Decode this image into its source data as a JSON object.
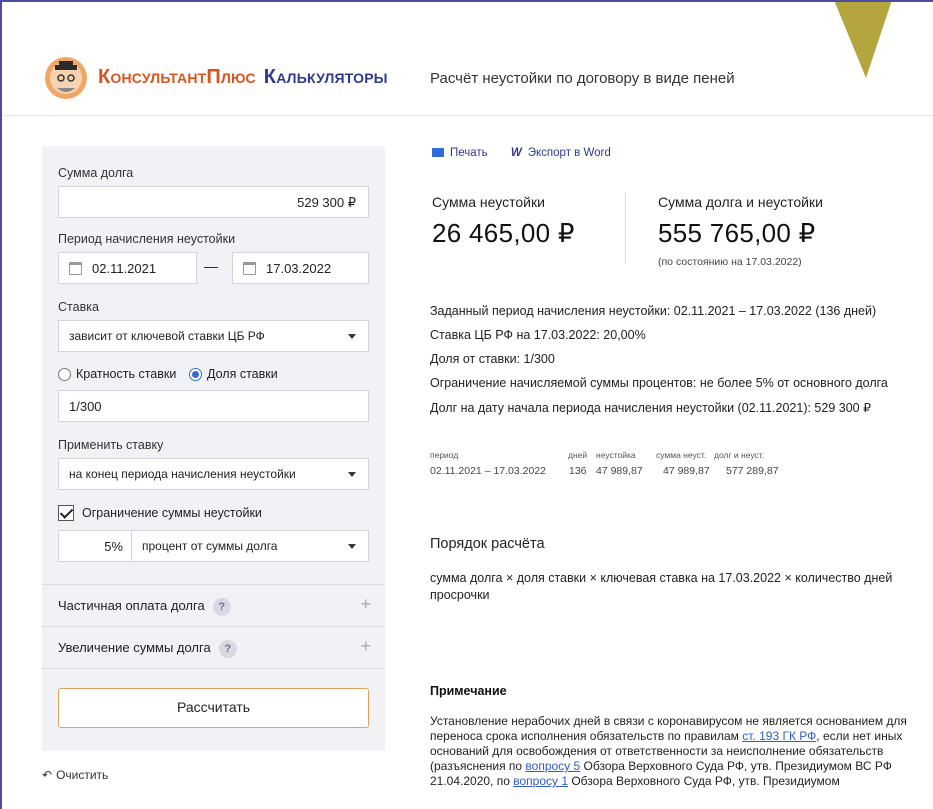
{
  "header": {
    "brand_part1": "КонсультантПлюс",
    "brand_part2": "Калькуляторы",
    "page_title": "Расчёт неустойки по договору в виде пеней"
  },
  "form": {
    "debt_label": "Сумма долга",
    "debt_value": "529 300 ₽",
    "period_label": "Период начисления неустойки",
    "date_from": "02.11.2021",
    "date_to": "17.03.2022",
    "rate_label": "Ставка",
    "rate_value": "зависит от ключевой ставки ЦБ РФ",
    "radio_multiple": "Кратность ставки",
    "radio_share": "Доля ставки",
    "share_value": "1/300",
    "apply_label": "Применить ставку",
    "apply_value": "на конец периода начисления неустойки",
    "limit_label": "Ограничение суммы неустойки",
    "limit_percent": "5%",
    "limit_type": "процент от суммы долга",
    "partial_payment": "Частичная оплата долга",
    "debt_increase": "Увеличение суммы долга",
    "help_mark": "?",
    "plus_mark": "+",
    "calculate": "Рассчитать",
    "clear": "Очистить"
  },
  "toolbar": {
    "print": "Печать",
    "export_word": "Экспорт в Word"
  },
  "result": {
    "penalty_label": "Сумма неустойки",
    "penalty_value": "26 465,00 ₽",
    "total_label": "Сумма долга и неустойки",
    "total_value": "555 765,00 ₽",
    "as_of": "(по состоянию на 17.03.2022)",
    "info_lines": [
      "Заданный период начисления неустойки: 02.11.2021 – 17.03.2022 (136 дней)",
      "Ставка ЦБ РФ на 17.03.2022: 20,00%",
      "Доля от ставки: 1/300",
      "Ограничение начисляемой суммы процентов: не более 5% от основного долга",
      "Долг на дату начала периода начисления неустойки (02.11.2021): 529 300 ₽"
    ]
  },
  "table": {
    "headers": [
      "период",
      "дней",
      "неустойка",
      "сумма неуст.",
      "долг и неуст."
    ],
    "row": [
      "02.11.2021 – 17.03.2022",
      "136",
      "47 989,87",
      "47 989,87",
      "577 289,87"
    ]
  },
  "procedure": {
    "title": "Порядок расчёта",
    "formula": "сумма долга × доля ставки × ключевая ставка на 17.03.2022 × количество дней просрочки"
  },
  "note": {
    "title": "Примечание",
    "text1": "Установление нерабочих дней в связи с коронавирусом не является основанием для переноса срока исполнения обязательств по правилам ",
    "link1": "ст. 193 ГК РФ",
    "text2": ", если нет иных оснований для освобождения от ответственности за неисполнение обязательств (разъяснения по ",
    "link2": "вопросу 5",
    "text3": " Обзора Верховного Суда РФ, утв. Президиумом ВС РФ 21.04.2020, по ",
    "link3": "вопросу 1",
    "text4": " Обзора Верховного Суда РФ, утв. Президиумом"
  },
  "colors": {
    "brand_orange": "#d9531e",
    "brand_blue": "#2f3a8f",
    "accent_button_border": "#e0a45e",
    "link": "#2f5cc4",
    "panel_bg": "#f1f2f5"
  }
}
